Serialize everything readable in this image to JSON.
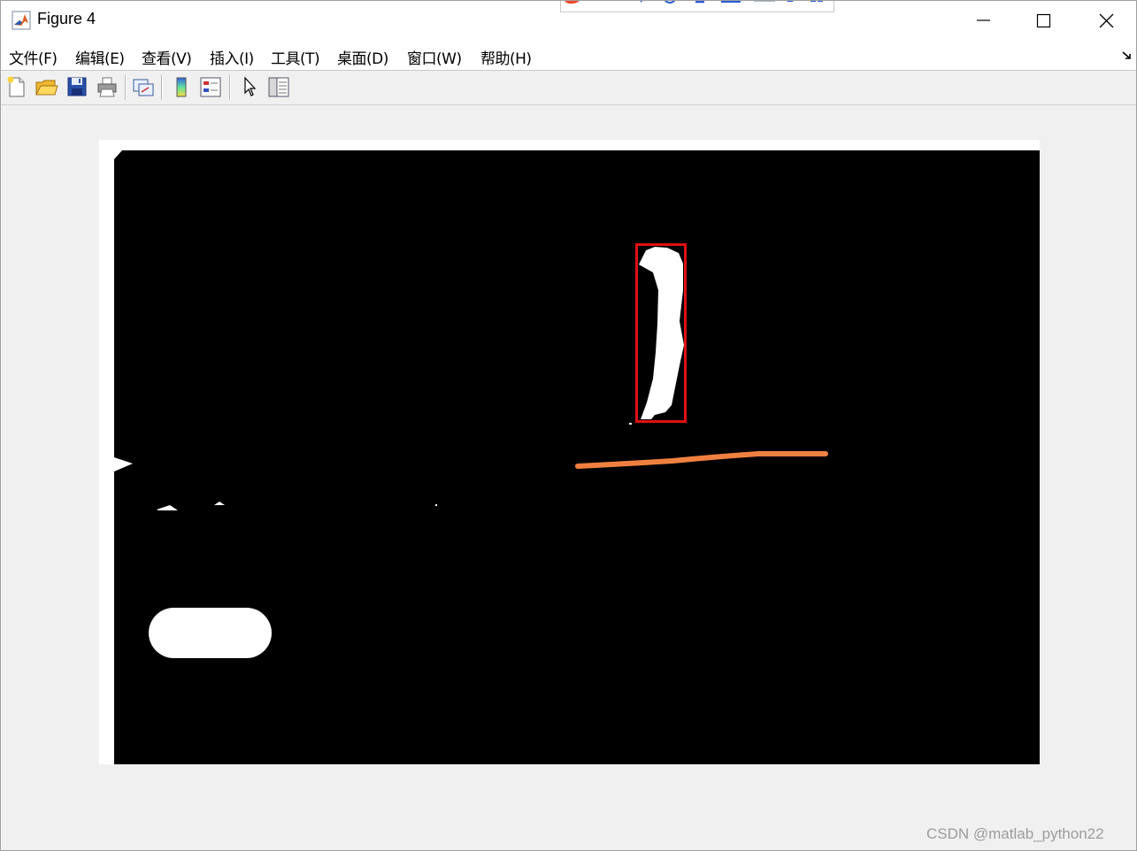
{
  "window": {
    "title": "Figure 4",
    "icon": "matlab-icon"
  },
  "menu": {
    "items": [
      {
        "label": "文件(F)"
      },
      {
        "label": "编辑(E)"
      },
      {
        "label": "查看(V)"
      },
      {
        "label": "插入(I)"
      },
      {
        "label": "工具(T)"
      },
      {
        "label": "桌面(D)"
      },
      {
        "label": "窗口(W)"
      },
      {
        "label": "帮助(H)"
      }
    ]
  },
  "toolbar": {
    "buttons": [
      {
        "icon": "new-figure-icon"
      },
      {
        "icon": "open-file-icon"
      },
      {
        "icon": "save-icon"
      },
      {
        "icon": "print-icon"
      },
      {
        "icon": "link-plot-icon"
      },
      {
        "icon": "insert-colorbar-icon"
      },
      {
        "icon": "insert-legend-icon"
      },
      {
        "icon": "edit-plot-arrow-icon"
      },
      {
        "icon": "property-inspector-icon"
      }
    ]
  },
  "colors": {
    "image_background": "#000000",
    "blob": "#ffffff",
    "bounding_box": "#e01010",
    "annotation_line": "#f08040"
  },
  "watermark": {
    "text": "CSDN @matlab_python22"
  }
}
